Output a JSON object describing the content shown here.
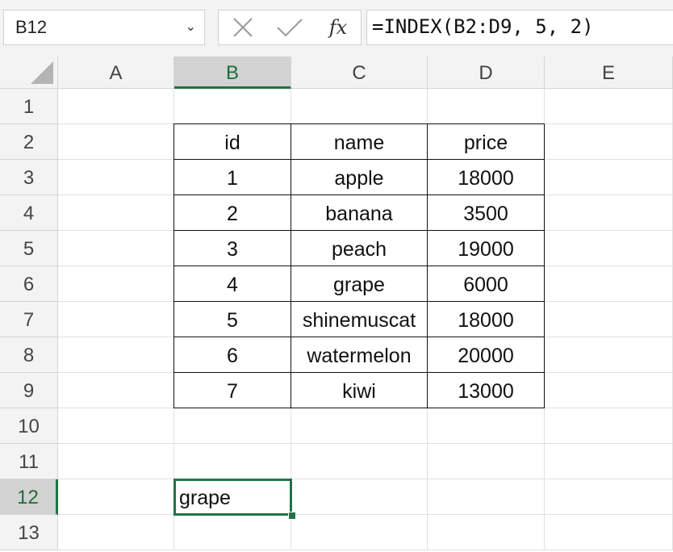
{
  "name_box": {
    "value": "B12",
    "chevron": "⌄"
  },
  "formula_bar": {
    "cancel_icon": "✕",
    "enter_icon": "✓",
    "fx_label": "fx",
    "formula": "=INDEX(B2:D9, 5, 2)"
  },
  "columns": [
    "A",
    "B",
    "C",
    "D",
    "E"
  ],
  "rows": [
    "1",
    "2",
    "3",
    "4",
    "5",
    "6",
    "7",
    "8",
    "9",
    "10",
    "11",
    "12",
    "13"
  ],
  "selected_cell": {
    "column": "B",
    "row": "12",
    "value": "grape"
  },
  "table": {
    "headers": [
      "id",
      "name",
      "price"
    ],
    "rows": [
      [
        "1",
        "apple",
        "18000"
      ],
      [
        "2",
        "banana",
        "3500"
      ],
      [
        "3",
        "peach",
        "19000"
      ],
      [
        "4",
        "grape",
        "6000"
      ],
      [
        "5",
        "shinemuscat",
        "18000"
      ],
      [
        "6",
        "watermelon",
        "20000"
      ],
      [
        "7",
        "kiwi",
        "13000"
      ]
    ]
  },
  "colors": {
    "accent": "#217346",
    "header_bg": "#f3f3f3",
    "selected_header_bg": "#d2d2d2"
  }
}
